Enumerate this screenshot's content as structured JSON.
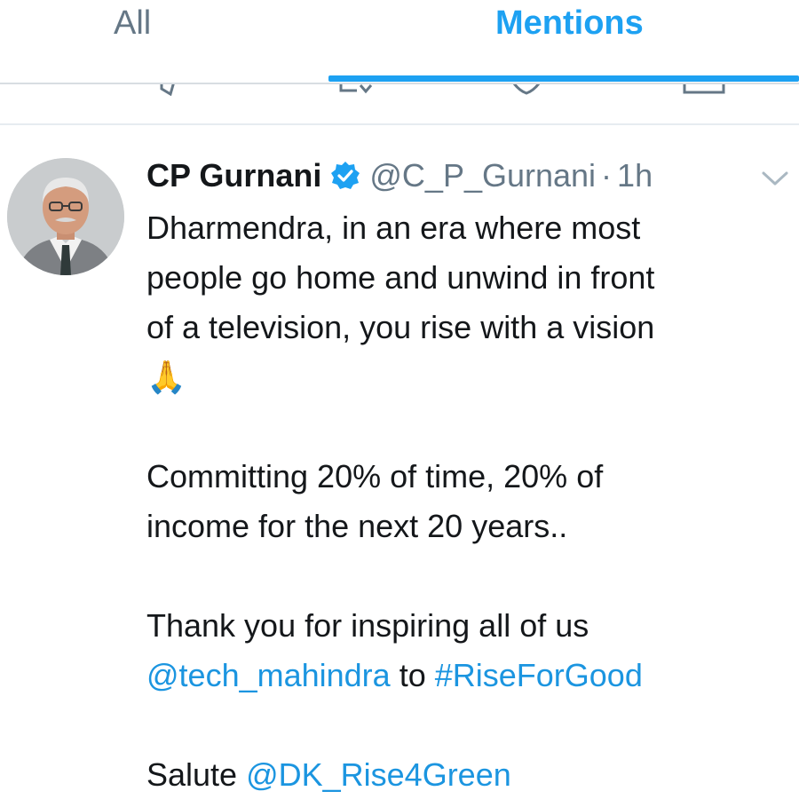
{
  "tabs": {
    "all_label": "All",
    "mentions_label": "Mentions",
    "active": "Mentions"
  },
  "tweet": {
    "display_name": "CP Gurnani",
    "handle": "@C_P_Gurnani",
    "separator": "·",
    "time": "1h",
    "verified": true,
    "body": {
      "line1": "Dharmendra, in an era where most",
      "line2": "people go home and unwind in front",
      "line3": "of a television, you rise with a vision",
      "emoji": "🙏",
      "line5": "Committing 20% of time, 20% of",
      "line6": "income for the next 20 years..",
      "line7": "Thank you for inspiring all of us",
      "mention_tech": "@tech_mahindra",
      "to_word": " to ",
      "hashtag": "#RiseForGood",
      "salute_word": "Salute ",
      "mention_dk": "@DK_Rise4Green"
    }
  },
  "colors": {
    "accent": "#1da1f2",
    "link": "#1b95e0",
    "muted": "#657786",
    "text": "#14171a"
  },
  "icons": [
    "verified-badge-icon",
    "chevron-down-icon",
    "reply-icon",
    "retweet-icon",
    "like-icon",
    "share-icon"
  ]
}
